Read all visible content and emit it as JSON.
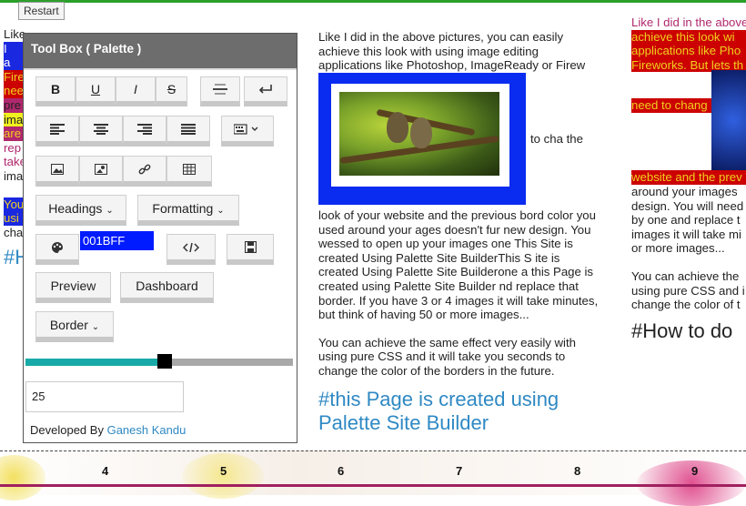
{
  "restart_label": "Restart",
  "toolbox": {
    "title": "Tool Box ( Palette )",
    "color_value": "001BFF",
    "headings_label": "Headings",
    "formatting_label": "Formatting",
    "preview_label": "Preview",
    "dashboard_label": "Dashboard",
    "border_label": "Border",
    "slider_value": 0.52,
    "number_value": "25",
    "developed_by": "Developed By",
    "author": "Ganesh Kandu",
    "format_buttons": [
      "B",
      "U",
      "I",
      "S"
    ]
  },
  "col1": [
    "Like",
    "I",
    "a",
    "Fire",
    "nee",
    "pre",
    "ima",
    "are",
    "rep",
    "take",
    "ima",
    "You",
    "usi",
    "cha"
  ],
  "col1_hash": "#H",
  "col2": {
    "para1": "Like I did in the above pictures, you can easily achieve this look with using image editing applications like Photoshop, ImageReady or Firew",
    "side_text": "to cha    the",
    "para2": "look of your website and the previous bord color you used around your ages doesn't fur new design. You wessed to open up your images one This Site is created Using Palette Site BuilderThis S  ite is created Using Palette Site Builderone a this Page is created using Palette Site Builder nd replace that border. If you have 3 or 4 images it will take minutes, but think of having 50 or more images...",
    "para3": "You can achieve the same effect very easily with using pure CSS and it will take you seconds to change the color of the borders in the future.",
    "heading": "#this Page is created using Palette Site Builder"
  },
  "col3": {
    "line1": "Like I did in the above",
    "line2": "achieve this look wi",
    "line3": "applications like Pho",
    "line4": "Fireworks. But lets th",
    "line5": "need to chang",
    "line6": "website and the prev",
    "line7": "around your images",
    "line8": "design. You will need",
    "line9": "by one and replace t",
    "line10": "images it will take mi",
    "line11": "or more images...",
    "line12": "You can achieve the",
    "line13": "using pure CSS and i",
    "line14": "change the color of t",
    "heading": "#How to do"
  },
  "strip_numbers": [
    "4",
    "5",
    "6",
    "7",
    "8",
    "9"
  ],
  "colors": {
    "accent_blue": "#001BFF",
    "teal": "#18aaa8",
    "link": "#2f89c4",
    "red": "#c00000"
  }
}
